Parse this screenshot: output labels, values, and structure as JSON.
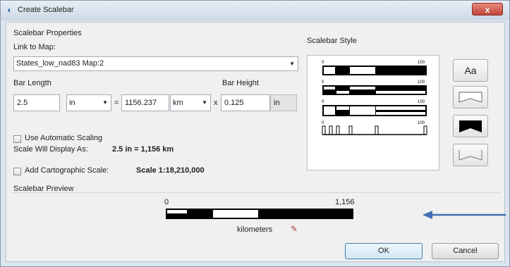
{
  "window": {
    "title": "Create Scalebar",
    "close_glyph": "x"
  },
  "properties": {
    "heading": "Scalebar Properties",
    "link_label": "Link to Map:",
    "map_value": "States_low_nad83 Map:2",
    "bar_length_label": "Bar Length",
    "bar_height_label": "Bar Height",
    "length_value": "2.5",
    "length_unit": "in",
    "equals": "=",
    "ground_value": "1156.237",
    "ground_unit": "km",
    "times": "x",
    "height_value": "0.125",
    "height_unit": "in",
    "auto_scaling_label": "Use Automatic Scaling",
    "display_prefix": "Scale Will Display As:",
    "display_value": "2.5 in = 1,156 km",
    "carto_label": "Add Cartographic Scale:",
    "carto_value": "Scale 1:18,210,000"
  },
  "style": {
    "heading": "Scalebar Style",
    "tick_start": "0",
    "tick_end": "100",
    "font_button_label": "Aa"
  },
  "preview": {
    "heading": "Scalebar Preview",
    "left_tick": "0",
    "right_tick": "1,156",
    "units": "kilometers"
  },
  "buttons": {
    "ok": "OK",
    "cancel": "Cancel"
  },
  "colors": {
    "annotation_arrow": "#3f6fb4"
  }
}
